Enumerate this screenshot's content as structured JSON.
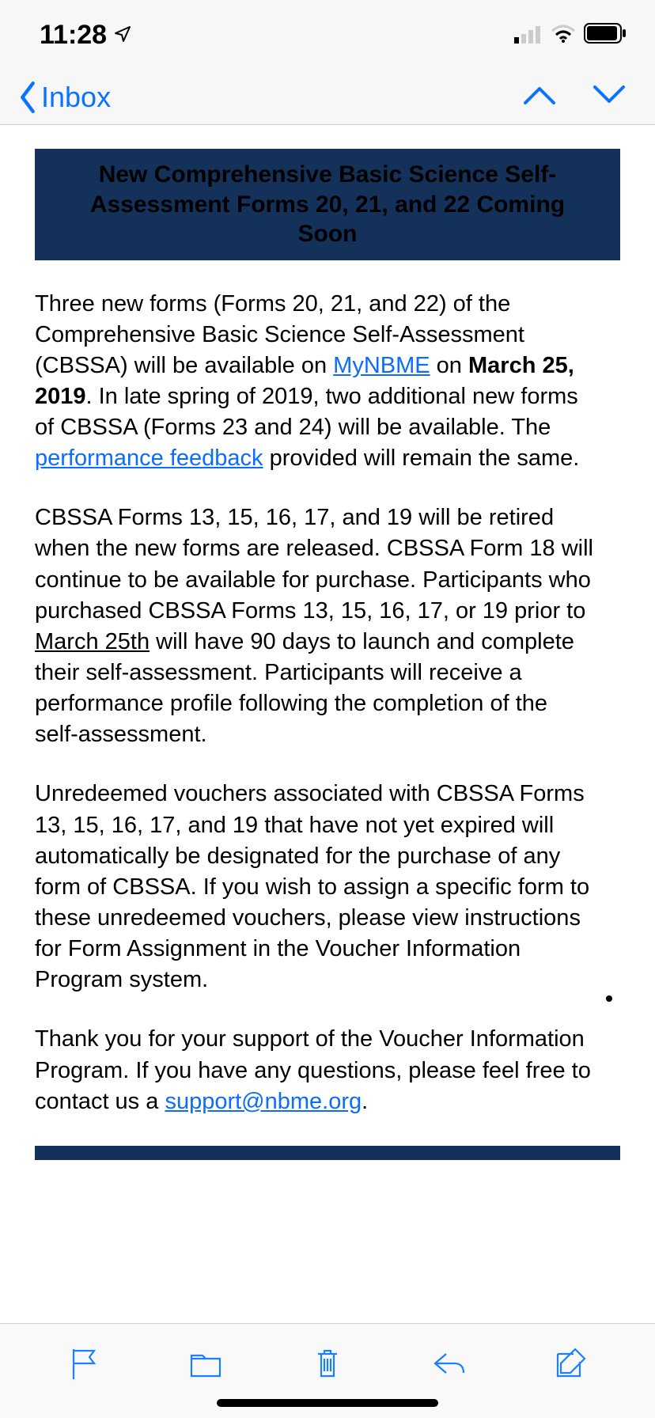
{
  "status": {
    "time": "11:28"
  },
  "nav": {
    "back_label": "Inbox"
  },
  "email": {
    "banner": "New Comprehensive Basic Science Self-Assessment Forms 20, 21, and 22 Coming Soon",
    "p1a": "Three new forms (Forms 20, 21, and 22) of the Comprehensive Basic Science Self-Assessment (CBSSA) will be available on ",
    "link1": "MyNBME",
    "p1b": " on ",
    "bold1": "March 25, 2019",
    "p1c": ". In late spring of 2019, two additional new forms of CBSSA (Forms 23 and 24) will be available. The ",
    "link2": "performance feedback",
    "p1d": " provided will remain the same.",
    "p2a": "CBSSA Forms 13, 15, 16, 17, and 19 will be retired when the new forms are released. CBSSA Form 18 will continue to be available for purchase. Participants who purchased CBSSA Forms 13, 15, 16, 17, or 19 prior to ",
    "ul1": "March 25th",
    "p2b": " will have 90 days to launch and complete their self-assessment. Participants will receive a performance profile following the completion of the self-assessment.",
    "p3": "Unredeemed vouchers associated with CBSSA Forms 13, 15, 16, 17, and 19 that have not yet expired will automatically be designated for the purchase of any form of CBSSA. If you wish to assign a specific form to these unredeemed vouchers, please view instructions for Form Assignment in the Voucher Information Program system.",
    "p4a": "Thank you for your support of the Voucher Information Program. If you have any questions, please feel free to contact us a ",
    "link3": "support@nbme.org",
    "p4b": "."
  }
}
